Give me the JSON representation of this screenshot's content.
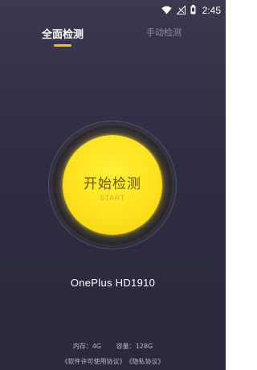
{
  "status_bar": {
    "time": "2:45",
    "icons": [
      "wifi-icon",
      "signal-off-icon",
      "battery-icon"
    ]
  },
  "tabs": [
    {
      "label": "全面检测",
      "active": true
    },
    {
      "label": "手动检测",
      "active": false
    }
  ],
  "start_button": {
    "title": "开始检测",
    "subtitle": "START"
  },
  "device": {
    "model": "OnePlus HD1910"
  },
  "specs": {
    "ram_label": "内存：",
    "ram_value": "4G",
    "storage_label": "容量：",
    "storage_value": "128G"
  },
  "footer": {
    "license_link": "《软件许可使用协议》",
    "privacy_link": "《隐私协议》"
  },
  "colors": {
    "accent": "#f6c10a",
    "button_yellow": "#fde21d",
    "background": "#332f45"
  }
}
